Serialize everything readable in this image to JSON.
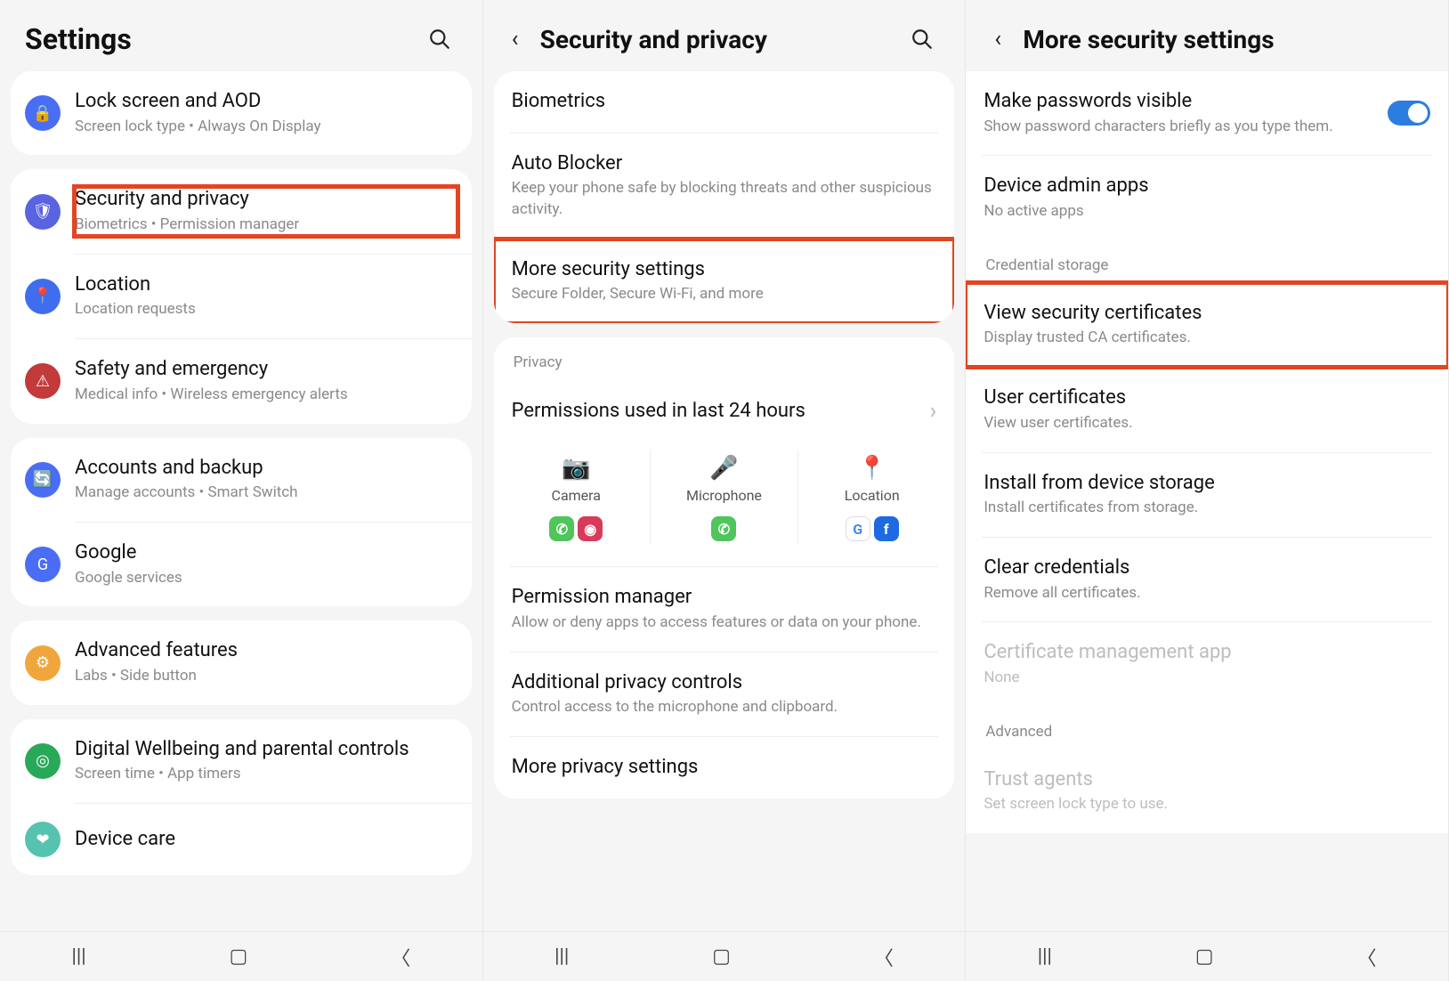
{
  "panel1": {
    "title": "Settings",
    "groups": [
      [
        {
          "id": "lock-screen",
          "icon": "lock",
          "color": "#4a6df5",
          "title": "Lock screen and AOD",
          "sub": "Screen lock type  •  Always On Display"
        }
      ],
      [
        {
          "id": "security-privacy",
          "icon": "shield",
          "color": "#5a63e0",
          "title": "Security and privacy",
          "sub": "Biometrics  •  Permission manager",
          "highlight": true
        },
        {
          "id": "location",
          "icon": "pin",
          "color": "#3f6df0",
          "title": "Location",
          "sub": "Location requests"
        },
        {
          "id": "safety",
          "icon": "alert",
          "color": "#c23a3a",
          "title": "Safety and emergency",
          "sub": "Medical info  •  Wireless emergency alerts"
        }
      ],
      [
        {
          "id": "accounts",
          "icon": "sync",
          "color": "#4a6df5",
          "title": "Accounts and backup",
          "sub": "Manage accounts  •  Smart Switch"
        },
        {
          "id": "google",
          "icon": "google",
          "color": "#4a6df5",
          "title": "Google",
          "sub": "Google services"
        }
      ],
      [
        {
          "id": "advanced",
          "icon": "gear",
          "color": "#f0a63c",
          "title": "Advanced features",
          "sub": "Labs  •  Side button"
        }
      ],
      [
        {
          "id": "wellbeing",
          "icon": "wellbeing",
          "color": "#2aa85a",
          "title": "Digital Wellbeing and parental controls",
          "sub": "Screen time  •  App timers"
        },
        {
          "id": "device-care",
          "icon": "care",
          "color": "#55c3b0",
          "title": "Device care",
          "sub": ""
        }
      ]
    ]
  },
  "panel2": {
    "title": "Security and privacy",
    "top_items": [
      {
        "id": "biometrics",
        "title": "Biometrics",
        "sub": ""
      },
      {
        "id": "auto-blocker",
        "title": "Auto Blocker",
        "sub": "Keep your phone safe by blocking threats and other suspicious activity."
      },
      {
        "id": "more-security",
        "title": "More security settings",
        "sub": "Secure Folder, Secure Wi-Fi, and more",
        "highlight": true
      }
    ],
    "privacy_label": "Privacy",
    "permissions_title": "Permissions used in last 24 hours",
    "permissions": [
      {
        "id": "camera",
        "label": "Camera",
        "icon": "camera",
        "apps": [
          {
            "name": "whatsapp",
            "color": "#4fc55b"
          },
          {
            "name": "instagram",
            "color": "#d93a5a"
          }
        ]
      },
      {
        "id": "microphone",
        "label": "Microphone",
        "icon": "mic",
        "apps": [
          {
            "name": "whatsapp",
            "color": "#4fc55b"
          }
        ]
      },
      {
        "id": "location",
        "label": "Location",
        "icon": "pin",
        "apps": [
          {
            "name": "google",
            "color": "#fff"
          },
          {
            "name": "facebook",
            "color": "#1d6ae2"
          }
        ]
      }
    ],
    "bottom_items": [
      {
        "id": "permission-manager",
        "title": "Permission manager",
        "sub": "Allow or deny apps to access features or data on your phone."
      },
      {
        "id": "additional-privacy",
        "title": "Additional privacy controls",
        "sub": "Control access to the microphone and clipboard."
      },
      {
        "id": "more-privacy",
        "title": "More privacy settings",
        "sub": ""
      }
    ]
  },
  "panel3": {
    "title": "More security settings",
    "items1": [
      {
        "id": "passwords-visible",
        "title": "Make passwords visible",
        "sub": "Show password characters briefly as you type them.",
        "toggle": true
      },
      {
        "id": "device-admin",
        "title": "Device admin apps",
        "sub": "No active apps"
      }
    ],
    "section1": "Credential storage",
    "items2": [
      {
        "id": "view-certs",
        "title": "View security certificates",
        "sub": "Display trusted CA certificates.",
        "highlight": true
      },
      {
        "id": "user-certs",
        "title": "User certificates",
        "sub": "View user certificates."
      },
      {
        "id": "install-storage",
        "title": "Install from device storage",
        "sub": "Install certificates from storage."
      },
      {
        "id": "clear-creds",
        "title": "Clear credentials",
        "sub": "Remove all certificates."
      },
      {
        "id": "cert-mgmt",
        "title": "Certificate management app",
        "sub": "None",
        "disabled": true
      }
    ],
    "section2": "Advanced",
    "items3": [
      {
        "id": "trust-agents",
        "title": "Trust agents",
        "sub": "Set screen lock type to use.",
        "disabled": true
      }
    ]
  },
  "icons": {
    "lock": "🔒",
    "shield": "🛡",
    "pin": "📍",
    "alert": "⚠",
    "sync": "🔄",
    "google": "G",
    "gear": "⚙",
    "wellbeing": "◎",
    "care": "❤",
    "camera": "📷",
    "mic": "🎤"
  }
}
